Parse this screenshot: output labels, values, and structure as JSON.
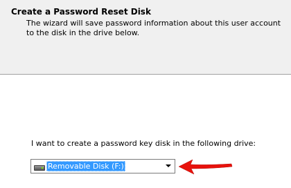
{
  "header": {
    "title": "Create a Password Reset Disk",
    "description": "The wizard will save password information about this user account to the disk in the drive below."
  },
  "main": {
    "prompt": "I want to create a password key disk in the following drive:",
    "drive_select": {
      "selected_value": "Removable Disk (F:)",
      "icon": "removable-drive-icon",
      "chevron_icon": "chevron-down-icon"
    },
    "annotation": {
      "icon": "red-arrow-icon",
      "color": "#e8120c"
    }
  },
  "colors": {
    "header_background": "#f0f0f0",
    "selection_highlight": "#3399ff",
    "annotation_red": "#e8120c"
  }
}
